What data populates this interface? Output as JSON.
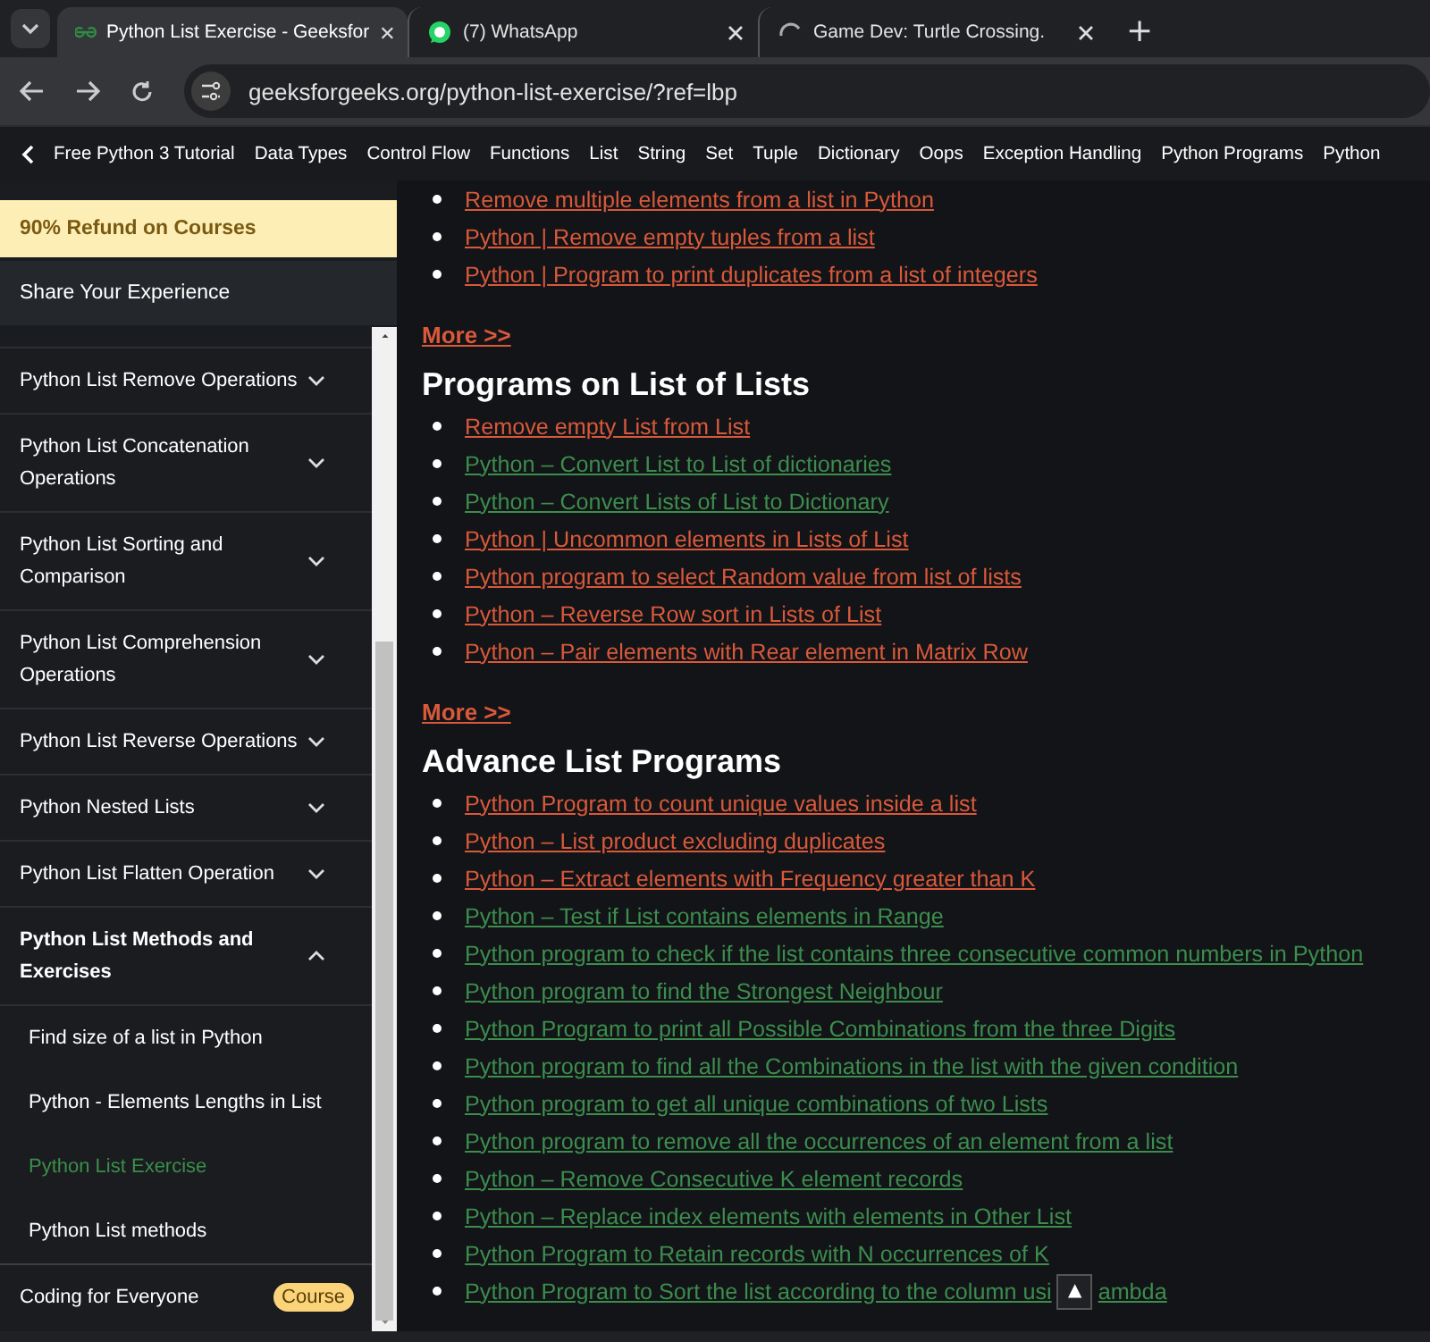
{
  "browser": {
    "tabs": [
      {
        "title": "Python List Exercise - Geeksfor",
        "kind": "gfg",
        "selected": true
      },
      {
        "title": "(7) WhatsApp",
        "kind": "whatsapp",
        "selected": false
      },
      {
        "title": "Game Dev: Turtle Crossing.",
        "kind": "loading",
        "selected": false
      }
    ],
    "new_tab": "+",
    "address": "geeksforgeeks.org/python-list-exercise/?ref=lbp"
  },
  "topic_nav": [
    "Free Python 3 Tutorial",
    "Data Types",
    "Control Flow",
    "Functions",
    "List",
    "String",
    "Set",
    "Tuple",
    "Dictionary",
    "Oops",
    "Exception Handling",
    "Python Programs",
    "Python"
  ],
  "sidebar": {
    "promo": "90% Refund on Courses",
    "share": "Share Your Experience",
    "items": [
      {
        "label": "Python List Remove Operations",
        "expanded": false
      },
      {
        "label": "Python List Concatenation Operations",
        "expanded": false
      },
      {
        "label": "Python List Sorting and Comparison",
        "expanded": false
      },
      {
        "label": "Python List Comprehension Operations",
        "expanded": false
      },
      {
        "label": "Python List Reverse Operations",
        "expanded": false
      },
      {
        "label": "Python Nested Lists",
        "expanded": false
      },
      {
        "label": "Python List Flatten Operation",
        "expanded": false
      },
      {
        "label": "Python List Methods and Exercises",
        "expanded": true,
        "children": [
          {
            "label": "Find size of a list in Python",
            "selected": false
          },
          {
            "label": "Python - Elements Lengths in List",
            "selected": false
          },
          {
            "label": "Python List Exercise",
            "selected": true
          },
          {
            "label": "Python List methods",
            "selected": false
          }
        ]
      }
    ],
    "footer": {
      "label": "Coding for Everyone",
      "badge": "Course"
    }
  },
  "content": {
    "sections": [
      {
        "links": [
          {
            "text": "Remove multiple elements from a list in Python",
            "visited": true
          },
          {
            "text": "Python | Remove empty tuples from a list",
            "visited": true
          },
          {
            "text": "Python | Program to print duplicates from a list of integers",
            "visited": true
          }
        ],
        "more": "More >>"
      },
      {
        "heading": "Programs on List of Lists",
        "links": [
          {
            "text": "Remove empty List from List",
            "visited": true
          },
          {
            "text": "Python – Convert List to List of dictionaries",
            "visited": false
          },
          {
            "text": "Python – Convert Lists of List to Dictionary",
            "visited": false
          },
          {
            "text": "Python | Uncommon elements in Lists of List",
            "visited": true
          },
          {
            "text": "Python program to select Random value from list of lists",
            "visited": true
          },
          {
            "text": "Python – Reverse Row sort in Lists of List",
            "visited": true
          },
          {
            "text": "Python – Pair elements with Rear element in Matrix Row",
            "visited": true
          }
        ],
        "more": "More >>"
      },
      {
        "heading": "Advance List Programs",
        "links": [
          {
            "text": "Python Program to count unique values inside a list",
            "visited": true
          },
          {
            "text": "Python – List product excluding duplicates",
            "visited": true
          },
          {
            "text": "Python – Extract elements with Frequency greater than K",
            "visited": true
          },
          {
            "text": "Python – Test if List contains elements in Range",
            "visited": false
          },
          {
            "text": "Python program to check if the list contains three consecutive common numbers in Python",
            "visited": false
          },
          {
            "text": "Python program to find the Strongest Neighbour",
            "visited": false
          },
          {
            "text": "Python Program to print all Possible Combinations from the three Digits",
            "visited": false
          },
          {
            "text": "Python program to find all the Combinations in the list with the given condition",
            "visited": false
          },
          {
            "text": "Python program to get all unique combinations of two Lists",
            "visited": false
          },
          {
            "text": "Python program to remove all the occurrences of an element from a list",
            "visited": false
          },
          {
            "text": "Python – Remove Consecutive K element records",
            "visited": false
          },
          {
            "text": "Python – Replace index elements with elements in Other List",
            "visited": false
          },
          {
            "text": "Python Program to Retain records with N occurrences of K",
            "visited": false
          },
          {
            "text": "Python Program to Sort the list according to the column usi",
            "text_after": "ambda",
            "visited": false
          }
        ]
      }
    ]
  },
  "scroll_top": "▲"
}
